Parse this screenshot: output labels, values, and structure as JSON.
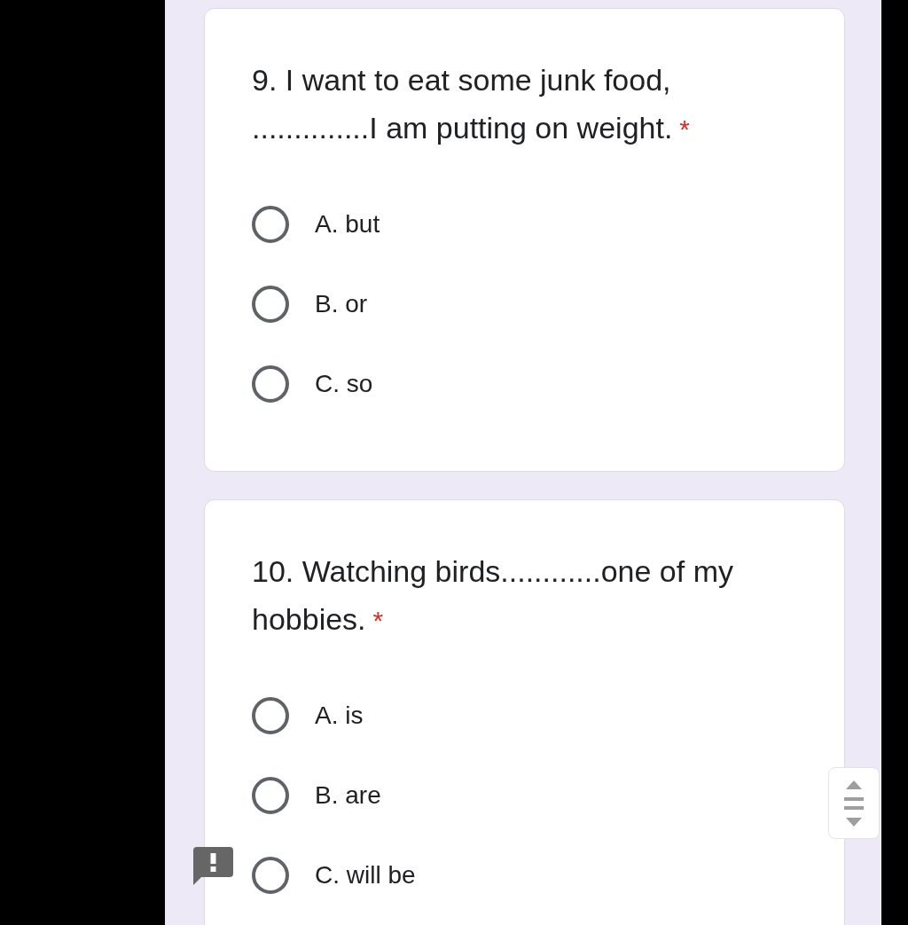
{
  "questions": [
    {
      "text": "9. I want to eat some junk food, ..............I am putting on weight.",
      "required_mark": "*",
      "options": [
        {
          "label": "A. but",
          "selected": false
        },
        {
          "label": "B. or",
          "selected": false
        },
        {
          "label": "C. so",
          "selected": false
        }
      ]
    },
    {
      "text": "10. Watching birds............one of my hobbies.",
      "required_mark": "*",
      "options": [
        {
          "label": "A. is",
          "selected": false
        },
        {
          "label": "B. are",
          "selected": false
        },
        {
          "label": "C. will be",
          "selected": false
        }
      ]
    }
  ]
}
